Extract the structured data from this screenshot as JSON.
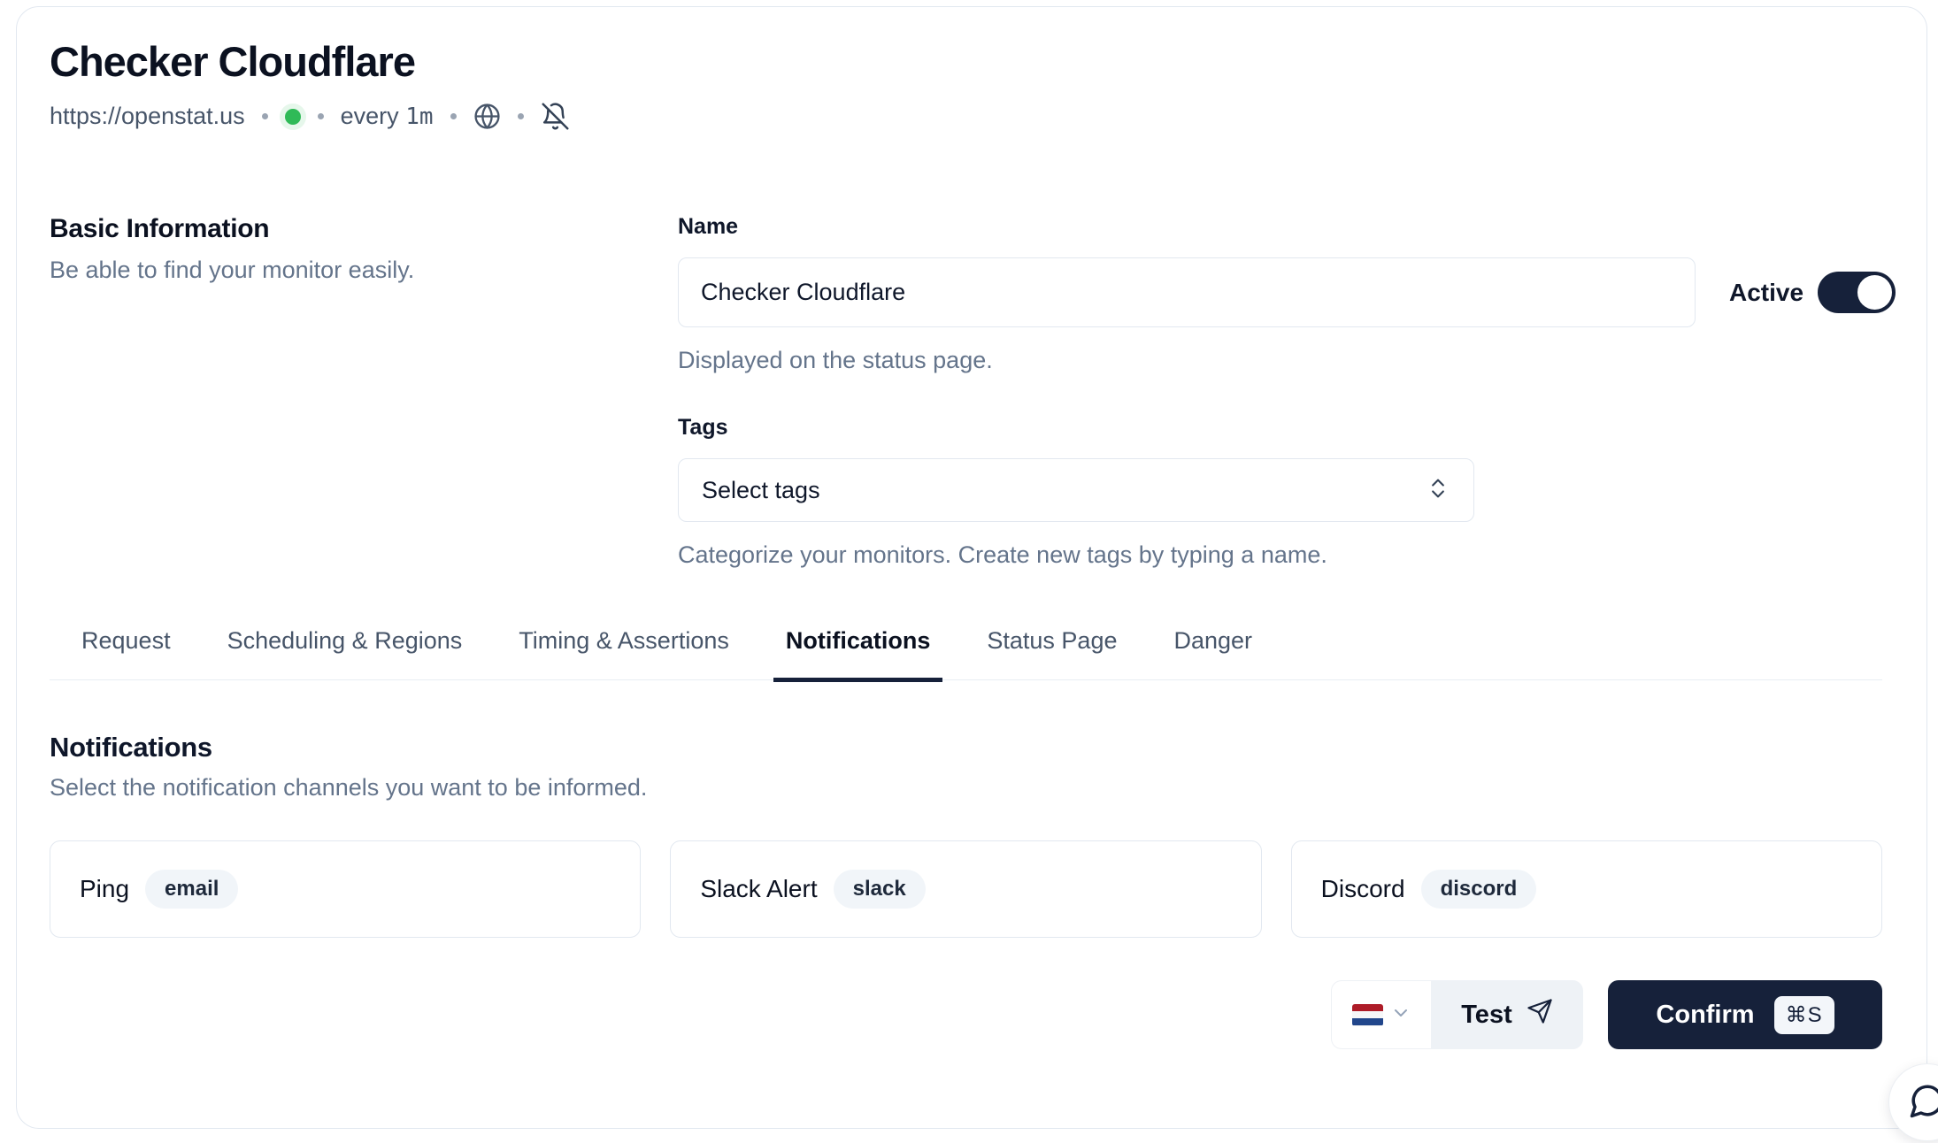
{
  "header": {
    "title": "Checker Cloudflare",
    "url": "https://openstat.us",
    "schedule_prefix": "every",
    "schedule_value": "1m",
    "status": "up"
  },
  "basic_information": {
    "heading": "Basic Information",
    "description": "Be able to find your monitor easily.",
    "name_label": "Name",
    "name_value": "Checker Cloudflare",
    "name_help": "Displayed on the status page.",
    "active_label": "Active",
    "active_on": true,
    "tags_label": "Tags",
    "tags_placeholder": "Select tags",
    "tags_help": "Categorize your monitors. Create new tags by typing a name."
  },
  "tabs": [
    {
      "label": "Request",
      "active": false
    },
    {
      "label": "Scheduling & Regions",
      "active": false
    },
    {
      "label": "Timing & Assertions",
      "active": false
    },
    {
      "label": "Notifications",
      "active": true
    },
    {
      "label": "Status Page",
      "active": false
    },
    {
      "label": "Danger",
      "active": false
    }
  ],
  "notifications": {
    "heading": "Notifications",
    "description": "Select the notification channels you want to be informed.",
    "channels": [
      {
        "name": "Ping",
        "provider": "email"
      },
      {
        "name": "Slack Alert",
        "provider": "slack"
      },
      {
        "name": "Discord",
        "provider": "discord"
      }
    ]
  },
  "footer": {
    "flag_icon": "netherlands-flag-icon",
    "test_label": "Test",
    "confirm_label": "Confirm",
    "confirm_shortcut": "⌘S"
  },
  "colors": {
    "accent_dark": "#16213a",
    "text_muted": "#64748b",
    "border": "#e2e8f0",
    "badge_bg": "#f1f5f9",
    "status_green": "#2fba57"
  }
}
